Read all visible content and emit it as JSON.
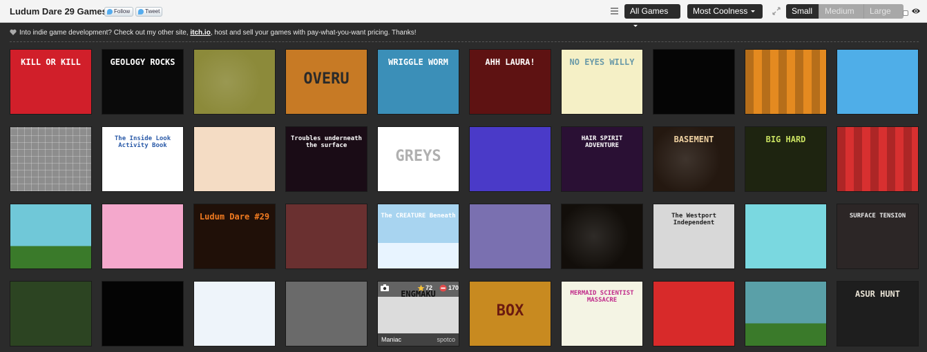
{
  "header": {
    "title": "Ludum Dare 29 Games",
    "follow_label": "Follow",
    "tweet_label": "Tweet",
    "filter_label": "All Games",
    "sort_label": "Most Coolness",
    "sizes": [
      "Small",
      "Medium",
      "Large"
    ],
    "active_size": "Small"
  },
  "notice": {
    "before": "Into indie game development? Check out my other site,",
    "link": "itch.io",
    "after": ", host and sell your games with pay-what-you-want pricing. Thanks!"
  },
  "games": [
    {
      "caption": "KILL OR KILL",
      "bg": "#d11f2a",
      "fg": "#ffffff"
    },
    {
      "caption": "GEOLOGY ROCKS",
      "bg": "#0a0a0a",
      "fg": "#ffffff"
    },
    {
      "caption": "",
      "bg": "#8c8a3a",
      "fg": "#ffffff"
    },
    {
      "caption": "OVERU",
      "bg": "#c77a25",
      "fg": "#2a2a2a"
    },
    {
      "caption": "WRIGGLE WORM",
      "bg": "#3b8fb8",
      "fg": "#ffffff"
    },
    {
      "caption": "AHH LAURA!",
      "bg": "#5e1212",
      "fg": "#ffffff"
    },
    {
      "caption": "NO EYES WILLY",
      "bg": "#f5f0c6",
      "fg": "#6a9aa8"
    },
    {
      "caption": "",
      "bg": "#050505",
      "fg": "#ffffff"
    },
    {
      "caption": "",
      "bg": "#e48a20",
      "fg": "#ffffff"
    },
    {
      "caption": "",
      "bg": "#4faee8",
      "fg": "#111111"
    },
    {
      "caption": "",
      "bg": "#8d8d8d",
      "fg": "#ffffff"
    },
    {
      "caption": "The Inside Look Activity Book",
      "bg": "#ffffff",
      "fg": "#2a5aa8"
    },
    {
      "caption": "",
      "bg": "#f4dcc4",
      "fg": "#c02a2a"
    },
    {
      "caption": "Troubles underneath the surface",
      "bg": "#1a0c16",
      "fg": "#ffffff"
    },
    {
      "caption": "GREYS",
      "bg": "#ffffff",
      "fg": "#b0b0b0"
    },
    {
      "caption": "",
      "bg": "#4a3ac8",
      "fg": "#ffffff"
    },
    {
      "caption": "HAIR SPIRIT ADVENTURE",
      "bg": "#2a1034",
      "fg": "#ffffff"
    },
    {
      "caption": "BASEMENT",
      "bg": "#241810",
      "fg": "#f0d2a2"
    },
    {
      "caption": "BIG HARD",
      "bg": "#1e2410",
      "fg": "#c8e060"
    },
    {
      "caption": "",
      "bg": "#d83030",
      "fg": "#ffffff"
    },
    {
      "caption": "",
      "bg": "#70c8d8",
      "fg": "#111111"
    },
    {
      "caption": "",
      "bg": "#f4a8cc",
      "fg": "#ffffff"
    },
    {
      "caption": "Ludum Dare #29",
      "bg": "#201008",
      "fg": "#f07a20"
    },
    {
      "caption": "",
      "bg": "#6a3030",
      "fg": "#ffffff"
    },
    {
      "caption": "The CREATURE Beneath",
      "bg": "#a8d4f0",
      "fg": "#ffffff"
    },
    {
      "caption": "",
      "bg": "#7a70b0",
      "fg": "#ffffff"
    },
    {
      "caption": "",
      "bg": "#120e0a",
      "fg": "#ffffff"
    },
    {
      "caption": "The Westport Independent",
      "bg": "#d8d8d8",
      "fg": "#222222"
    },
    {
      "caption": "",
      "bg": "#7ad8e0",
      "fg": "#c02a2a"
    },
    {
      "caption": "SURFACE TENSION",
      "bg": "#2c2626",
      "fg": "#e8e8e8"
    },
    {
      "caption": "",
      "bg": "#2c4422",
      "fg": "#ffffff"
    },
    {
      "caption": "",
      "bg": "#040404",
      "fg": "#ffffff"
    },
    {
      "caption": "",
      "bg": "#eef4fa",
      "fg": "#2a5aa8"
    },
    {
      "caption": "",
      "bg": "#6a6a6a",
      "fg": "#ffffff"
    },
    {
      "caption": "ENGMAKU",
      "bg": "#dcdcdc",
      "fg": "#222222"
    },
    {
      "caption": "BOX",
      "bg": "#c88a20",
      "fg": "#6a1a10"
    },
    {
      "caption": "MERMAID SCIENTIST MASSACRE",
      "bg": "#f4f4e4",
      "fg": "#c02a8a"
    },
    {
      "caption": "",
      "bg": "#d82a2a",
      "fg": "#ffffff"
    },
    {
      "caption": "",
      "bg": "#5aa0a8",
      "fg": "#ffffff"
    },
    {
      "caption": "ASUR HUNT",
      "bg": "#1e1e1e",
      "fg": "#e8e2d4"
    }
  ],
  "hovered": {
    "title": "Maniac",
    "author": "spotco",
    "stars": "72",
    "votes": "170"
  }
}
